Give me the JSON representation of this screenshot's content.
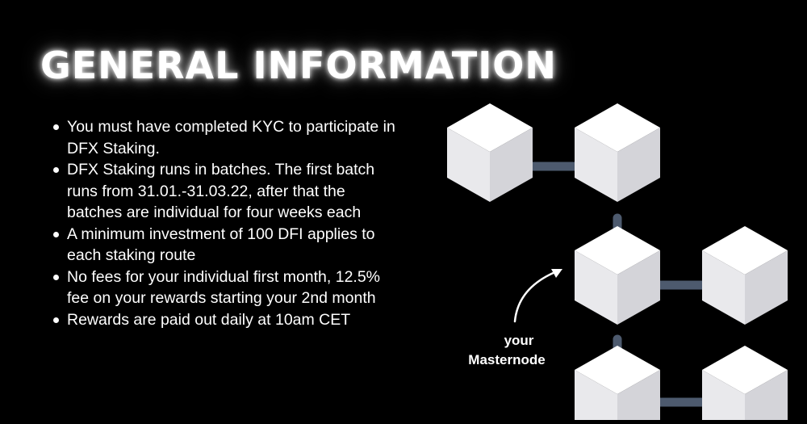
{
  "header": {
    "title": "GENERAL INFORMATION"
  },
  "info": {
    "items": [
      "You must have completed KYC to participate in DFX Staking.",
      "DFX Staking runs in batches. The first batch runs from 31.01.-31.03.22, after that the batches are individual for four weeks each",
      "A minimum investment of 100 DFI applies to each staking route",
      "No fees for your individual first month, 12.5% fee on your rewards starting your 2nd month",
      "Rewards are paid out daily at 10am CET"
    ]
  },
  "diagram": {
    "label_line1": "your",
    "label_line2": "Masternode",
    "colors": {
      "cube_top": "#ffffff",
      "cube_left": "#e9e9ec",
      "cube_right": "#d4d4d9",
      "connector": "#4d5a6e"
    }
  }
}
